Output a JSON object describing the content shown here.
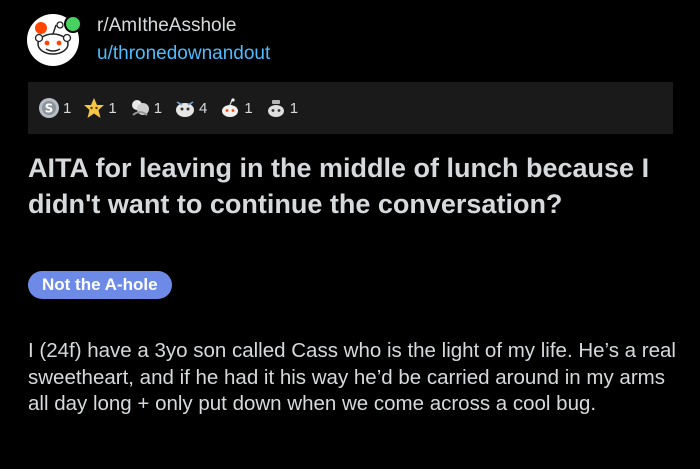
{
  "post": {
    "subreddit": "r/AmItheAsshole",
    "author": "u/thronedownandout",
    "title": "AITA for leaving in the middle of lunch because I didn't want to continue the conversation?",
    "flair": "Not the A-hole",
    "body": "I (24f) have a 3yo son called Cass who is the light of my life. He’s a real sweetheart, and if he had it his way he’d be carried around in my arms all day long + only put down when we come across a cool bug."
  },
  "awards": [
    {
      "icon": "silver-award-icon",
      "count": "1"
    },
    {
      "icon": "wholesome-award-icon",
      "count": "1"
    },
    {
      "icon": "hugz-award-icon",
      "count": "1"
    },
    {
      "icon": "take-my-energy-award-icon",
      "count": "4"
    },
    {
      "icon": "snoo-award-icon",
      "count": "1"
    },
    {
      "icon": "helpful-award-icon",
      "count": "1"
    }
  ],
  "colors": {
    "background": "#000000",
    "text": "#d7dadc",
    "username": "#4fbcff",
    "flair_bg": "#6d8be6",
    "awards_bar": "#1a1a1b"
  }
}
